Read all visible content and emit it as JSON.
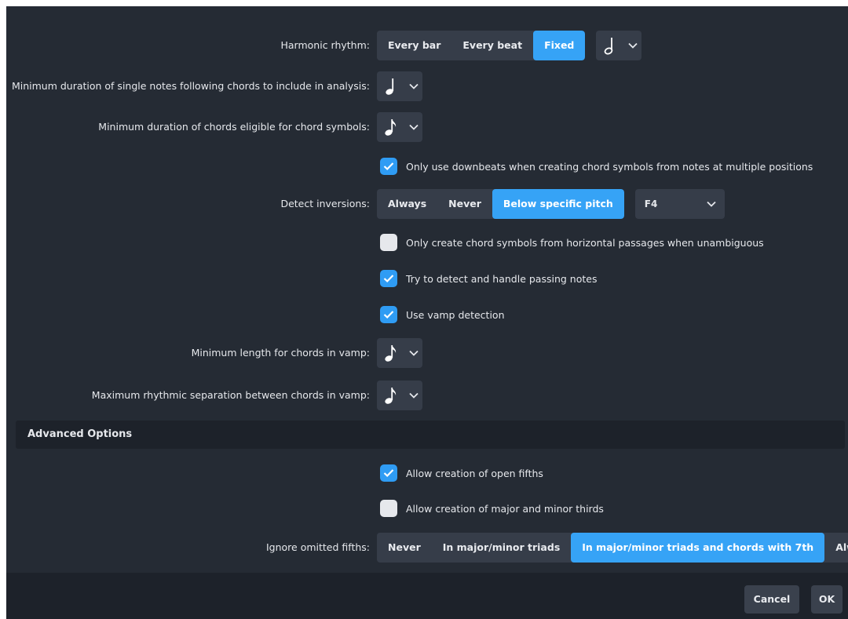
{
  "harmonic_rhythm": {
    "label": "Harmonic rhythm:",
    "options": [
      "Every bar",
      "Every beat",
      "Fixed"
    ],
    "selected": "Fixed",
    "note_value": "half-note-icon"
  },
  "min_single_notes": {
    "label": "Minimum duration of single notes following chords to include in analysis:",
    "note_value": "quarter-note-icon"
  },
  "min_chord_duration": {
    "label": "Minimum duration of chords eligible for chord symbols:",
    "note_value": "eighth-note-icon"
  },
  "only_downbeats": {
    "label": "Only use downbeats when creating chord symbols from notes at multiple positions",
    "checked": true
  },
  "detect_inversions": {
    "label": "Detect inversions:",
    "options": [
      "Always",
      "Never",
      "Below specific pitch"
    ],
    "selected": "Below specific pitch",
    "pitch": "F4"
  },
  "horizontal_passages": {
    "label": "Only create chord symbols from horizontal passages when unambiguous",
    "checked": false
  },
  "passing_notes": {
    "label": "Try to detect and handle passing notes",
    "checked": true
  },
  "vamp_detection": {
    "label": "Use vamp detection",
    "checked": true
  },
  "vamp_min_length": {
    "label": "Minimum length for chords in vamp:",
    "note_value": "eighth-note-icon"
  },
  "vamp_max_separation": {
    "label": "Maximum rhythmic separation between chords in vamp:",
    "note_value": "eighth-note-icon"
  },
  "advanced": {
    "title": "Advanced Options",
    "open_fifths": {
      "label": "Allow creation of open fifths",
      "checked": true
    },
    "thirds": {
      "label": "Allow creation of major and minor thirds",
      "checked": false
    },
    "omitted_fifths": {
      "label": "Ignore omitted fifths:",
      "options": [
        "Never",
        "In major/minor triads",
        "In major/minor triads and chords with 7th",
        "Always"
      ],
      "selected": "In major/minor triads and chords with 7th"
    }
  },
  "footer": {
    "cancel": "Cancel",
    "ok": "OK"
  },
  "colors": {
    "accent": "#36a3f6",
    "background": "#252b34",
    "control": "#363d49",
    "section": "#1d222a"
  }
}
